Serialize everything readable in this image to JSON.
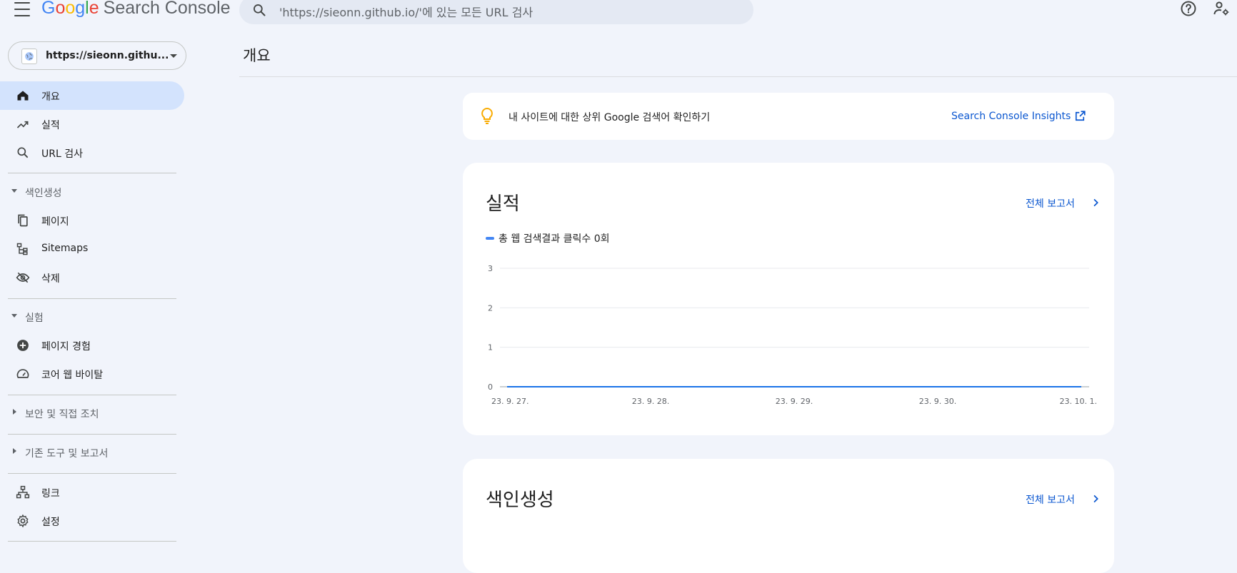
{
  "header": {
    "logo_letters": [
      "G",
      "o",
      "o",
      "g",
      "l",
      "e"
    ],
    "product": "Search Console",
    "search_placeholder": "'https://sieonn.github.io/'에 있는 모든 URL 검사"
  },
  "property": {
    "label": "https://sieonn.githu..."
  },
  "nav": {
    "overview": "개요",
    "performance": "실적",
    "url_inspection": "URL 검사",
    "section_indexing": "색인생성",
    "pages": "페이지",
    "sitemaps": "Sitemaps",
    "removals": "삭제",
    "section_experience": "실험",
    "page_experience": "페이지 경험",
    "core_web_vitals": "코어 웹 바이탈",
    "section_security": "보안 및 직접 조치",
    "section_legacy": "기존 도구 및 보고서",
    "links": "링크",
    "settings": "설정"
  },
  "main": {
    "page_title": "개요",
    "insight_text": "내 사이트에 대한 상위 Google 검색어 확인하기",
    "insight_link": "Search Console Insights",
    "performance_title": "실적",
    "performance_link": "전체 보고서",
    "indexing_title": "색인생성",
    "indexing_link": "전체 보고서"
  },
  "chart_data": {
    "type": "line",
    "categories": [
      "23. 9. 27.",
      "23. 9. 28.",
      "23. 9. 29.",
      "23. 9. 30.",
      "23. 10. 1."
    ],
    "series": [
      {
        "name": "총 웹 검색결과 클릭수 0회",
        "values": [
          0,
          0,
          0,
          0,
          0
        ]
      }
    ],
    "yticks": [
      0,
      1,
      2,
      3
    ],
    "ylim": [
      0,
      3
    ],
    "grid": true,
    "legend": "top-left",
    "color": "#1a73e8"
  },
  "colors": {
    "accent": "#0b57d0",
    "active_nav": "#d3e3fd",
    "background": "#f1f4fb"
  },
  "icons": {
    "menu": "hamburger-icon",
    "search": "search-icon",
    "help": "help-icon",
    "account": "account-settings-icon",
    "overview": "home-icon",
    "performance": "trending-up-icon",
    "url": "search-icon",
    "pages": "pages-icon",
    "sitemaps": "sitemap-icon",
    "removals": "visibility-off-icon",
    "page_experience": "add-circle-icon",
    "cwv": "speed-icon",
    "links": "link-network-icon",
    "settings": "gear-icon",
    "insight": "lightbulb-icon",
    "external": "open-in-new-icon",
    "chevron": "chevron-right-icon"
  }
}
